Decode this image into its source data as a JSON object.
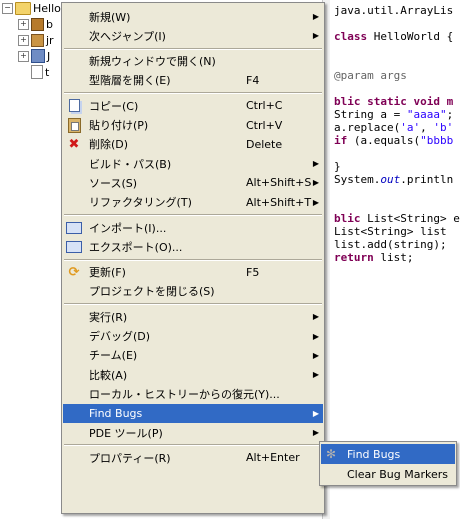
{
  "tree": {
    "root_label": "HelloWo...",
    "rows": [
      {
        "expander": "−",
        "icon": "folder-icon",
        "label": "HelloWo..."
      },
      {
        "expander": "+",
        "icon": "package-icon",
        "label": "b"
      },
      {
        "expander": "+",
        "icon": "package-icon",
        "label": "jr"
      },
      {
        "expander": "+",
        "icon": "library-icon",
        "label": "J"
      },
      {
        "expander": "",
        "icon": "file-icon",
        "label": "t"
      }
    ]
  },
  "editor": {
    "lines": [
      {
        "segments": [
          {
            "t": "java.util.ArrayLis",
            "c": ""
          }
        ]
      },
      {
        "segments": [
          {
            "t": "",
            "c": ""
          }
        ]
      },
      {
        "segments": [
          {
            "t": "class",
            "c": "kw"
          },
          {
            "t": " HelloWorld {",
            "c": ""
          }
        ]
      },
      {
        "segments": [
          {
            "t": "",
            "c": ""
          }
        ]
      },
      {
        "segments": [
          {
            "t": "",
            "c": ""
          }
        ]
      },
      {
        "segments": [
          {
            "t": "@param args",
            "c": "ann"
          }
        ]
      },
      {
        "segments": [
          {
            "t": "",
            "c": ""
          }
        ]
      },
      {
        "segments": [
          {
            "t": "blic static void m",
            "c": "kw"
          }
        ]
      },
      {
        "segments": [
          {
            "t": "String a = ",
            "c": ""
          },
          {
            "t": "\"aaaa\"",
            "c": "str"
          },
          {
            "t": ";",
            "c": ""
          }
        ]
      },
      {
        "segments": [
          {
            "t": "a.replace(",
            "c": ""
          },
          {
            "t": "'a'",
            "c": "str"
          },
          {
            "t": ", ",
            "c": ""
          },
          {
            "t": "'b'",
            "c": "str"
          }
        ]
      },
      {
        "segments": [
          {
            "t": "if",
            "c": "kw"
          },
          {
            "t": " (a.equals(",
            "c": ""
          },
          {
            "t": "\"bbbb",
            "c": "str"
          }
        ]
      },
      {
        "segments": [
          {
            "t": "",
            "c": ""
          }
        ]
      },
      {
        "segments": [
          {
            "t": "}",
            "c": ""
          }
        ]
      },
      {
        "segments": [
          {
            "t": "System.",
            "c": ""
          },
          {
            "t": "out",
            "c": "ital"
          },
          {
            "t": ".println",
            "c": ""
          }
        ]
      },
      {
        "segments": [
          {
            "t": "",
            "c": ""
          }
        ]
      },
      {
        "segments": [
          {
            "t": "",
            "c": ""
          }
        ]
      },
      {
        "segments": [
          {
            "t": "blic",
            "c": "kw"
          },
          {
            "t": " List<String> e",
            "c": ""
          }
        ]
      },
      {
        "segments": [
          {
            "t": "List<String> list",
            "c": ""
          }
        ]
      },
      {
        "segments": [
          {
            "t": "list.add(string);",
            "c": ""
          }
        ]
      },
      {
        "segments": [
          {
            "t": "return",
            "c": "kw"
          },
          {
            "t": " list;",
            "c": ""
          }
        ]
      }
    ]
  },
  "context_menu": {
    "items": [
      {
        "name": "new",
        "label": "新規(W)",
        "accel": "",
        "arrow": true,
        "icon": ""
      },
      {
        "name": "goto",
        "label": "次へジャンプ(I)",
        "accel": "",
        "arrow": true,
        "icon": ""
      },
      {
        "sep": true
      },
      {
        "name": "open-in-new-window",
        "label": "新規ウィンドウで開く(N)",
        "accel": "",
        "arrow": false,
        "icon": ""
      },
      {
        "name": "open-type-hierarchy",
        "label": "型階層を開く(E)",
        "accel": "F4",
        "arrow": false,
        "icon": ""
      },
      {
        "sep": true
      },
      {
        "name": "copy",
        "label": "コピー(C)",
        "accel": "Ctrl+C",
        "arrow": false,
        "icon": "copy-icon"
      },
      {
        "name": "paste",
        "label": "貼り付け(P)",
        "accel": "Ctrl+V",
        "arrow": false,
        "icon": "paste-icon"
      },
      {
        "name": "delete",
        "label": "削除(D)",
        "accel": "Delete",
        "arrow": false,
        "icon": "delete-icon"
      },
      {
        "name": "build-path",
        "label": "ビルド・パス(B)",
        "accel": "",
        "arrow": true,
        "icon": ""
      },
      {
        "name": "source",
        "label": "ソース(S)",
        "accel": "Alt+Shift+S",
        "arrow": true,
        "icon": ""
      },
      {
        "name": "refactoring",
        "label": "リファクタリング(T)",
        "accel": "Alt+Shift+T",
        "arrow": true,
        "icon": ""
      },
      {
        "sep": true
      },
      {
        "name": "import",
        "label": "インポート(I)...",
        "accel": "",
        "arrow": false,
        "icon": "import-icon"
      },
      {
        "name": "export",
        "label": "エクスポート(O)...",
        "accel": "",
        "arrow": false,
        "icon": "export-icon"
      },
      {
        "sep": true
      },
      {
        "name": "refresh",
        "label": "更新(F)",
        "accel": "F5",
        "arrow": false,
        "icon": "refresh-icon"
      },
      {
        "name": "close-project",
        "label": "プロジェクトを閉じる(S)",
        "accel": "",
        "arrow": false,
        "icon": ""
      },
      {
        "sep": true
      },
      {
        "name": "run",
        "label": "実行(R)",
        "accel": "",
        "arrow": true,
        "icon": ""
      },
      {
        "name": "debug",
        "label": "デバッグ(D)",
        "accel": "",
        "arrow": true,
        "icon": ""
      },
      {
        "name": "team",
        "label": "チーム(E)",
        "accel": "",
        "arrow": true,
        "icon": ""
      },
      {
        "name": "compare",
        "label": "比較(A)",
        "accel": "",
        "arrow": true,
        "icon": ""
      },
      {
        "name": "restore-local-history",
        "label": "ローカル・ヒストリーからの復元(Y)...",
        "accel": "",
        "arrow": false,
        "icon": ""
      },
      {
        "name": "find-bugs",
        "label": "Find Bugs",
        "accel": "",
        "arrow": true,
        "icon": "",
        "selected": true
      },
      {
        "name": "pde-tools",
        "label": "PDE ツール(P)",
        "accel": "",
        "arrow": true,
        "icon": ""
      },
      {
        "sep": true
      },
      {
        "name": "properties",
        "label": "プロパティー(R)",
        "accel": "Alt+Enter",
        "arrow": false,
        "icon": ""
      }
    ]
  },
  "submenu": {
    "items": [
      {
        "name": "find-bugs-action",
        "label": "Find Bugs",
        "icon": "bug-icon",
        "selected": true
      },
      {
        "name": "clear-bug-markers",
        "label": "Clear Bug Markers",
        "icon": "",
        "selected": false
      }
    ]
  },
  "colors": {
    "menu_bg": "#ece9d8",
    "selection": "#316ac5",
    "keyword": "#7f0055",
    "string": "#2a00ff"
  }
}
